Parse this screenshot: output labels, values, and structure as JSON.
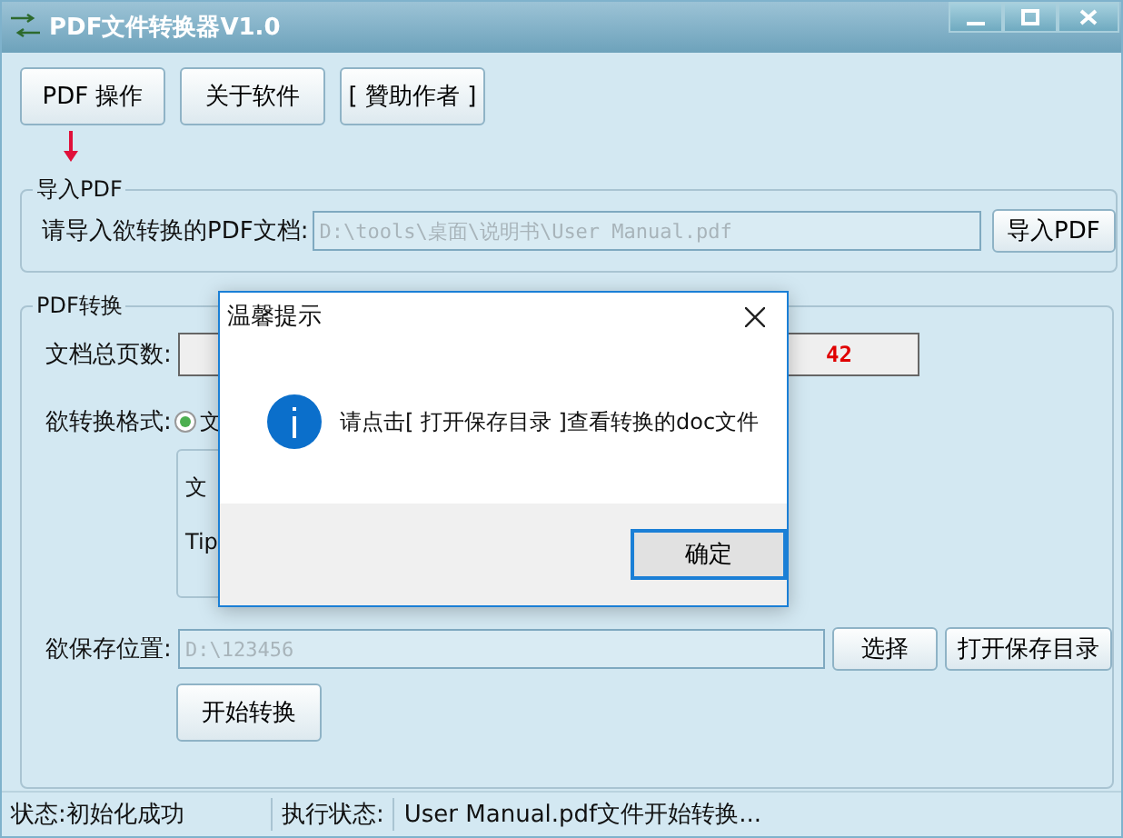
{
  "window": {
    "title": "PDF文件转换器V1.0"
  },
  "toolbar": [
    "PDF 操作",
    "关于软件",
    "[ 贊助作者 ]"
  ],
  "import_group": {
    "title": "导入PDF",
    "label": "请导入欲转换的PDF文档:",
    "value": "D:\\tools\\桌面\\说明书\\User Manual.pdf",
    "button": "导入PDF"
  },
  "convert_group": {
    "title": "PDF转换",
    "page_count_label": "文档总页数:",
    "page_count_value": "42",
    "format_label": "欲转换格式:",
    "format_options": [
      {
        "label": "文",
        "selected": true
      }
    ],
    "info_box": [
      "文",
      "Tip"
    ],
    "save_label": "欲保存位置:",
    "save_value": "D:\\123456",
    "choose_button": "选择",
    "open_button": "打开保存目录",
    "start_button": "开始转换"
  },
  "status_bar": {
    "status": "状态:初始化成功",
    "exec_label": "执行状态:",
    "exec_value": "User Manual.pdf文件开始转换..."
  },
  "dialog": {
    "title": "温馨提示",
    "message": "请点击[ 打开保存目录 ]查看转换的doc文件",
    "button": "确定"
  }
}
